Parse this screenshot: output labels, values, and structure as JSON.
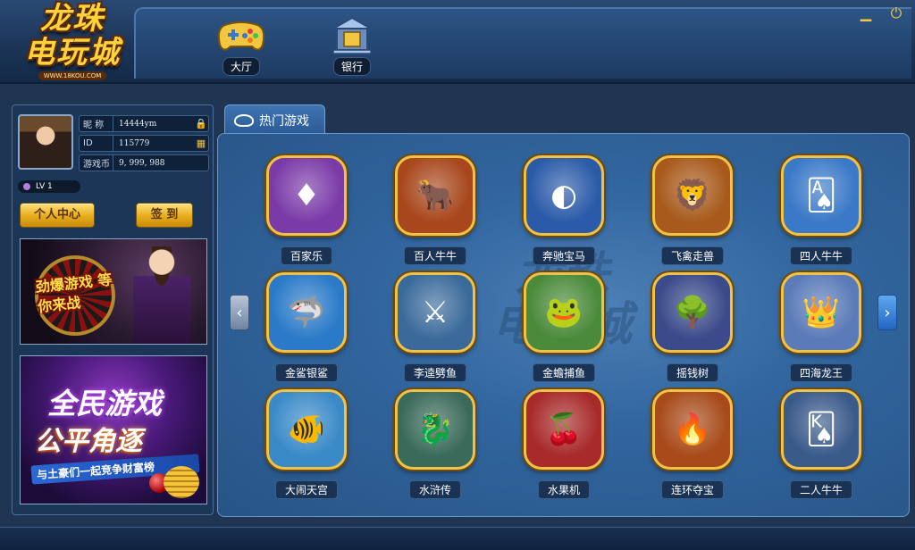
{
  "logo": {
    "line1": "龙珠",
    "line2": "电玩城",
    "url": "WWW.18KOU.COM"
  },
  "nav": [
    {
      "label": "大厅",
      "icon": "gamepad-icon"
    },
    {
      "label": "银行",
      "icon": "bank-icon"
    }
  ],
  "window": {
    "minimize_icon": "minimize-icon",
    "power_icon": "power-icon"
  },
  "user": {
    "nickname_label": "昵 称",
    "nickname": "14444ym",
    "id_label": "ID",
    "id": "115779",
    "coins_label": "游戏币",
    "coins": "9, 999, 988",
    "level": "LV  1"
  },
  "buttons": {
    "profile": "个人中心",
    "checkin": "签 到"
  },
  "banners": {
    "banner1_text": "劲爆游戏 等你来战",
    "banner2_title": "全民游戏",
    "banner2_title2": "公平角逐",
    "banner2_sub": "与土豪们一起竞争财富榜"
  },
  "tab": {
    "label": "热门游戏"
  },
  "watermark": "龙珠\n电玩城",
  "games": [
    {
      "label": "百家乐",
      "icon": "baccarat-icon",
      "bg": "#7a3aa8",
      "deco": "♦"
    },
    {
      "label": "百人牛牛",
      "icon": "bull-icon",
      "bg": "#a8461c",
      "deco": "🐂"
    },
    {
      "label": "奔驰宝马",
      "icon": "bmw-icon",
      "bg": "#2a5aa8",
      "deco": "◐"
    },
    {
      "label": "飞禽走兽",
      "icon": "lion-icon",
      "bg": "#a85a1c",
      "deco": "🦁"
    },
    {
      "label": "四人牛牛",
      "icon": "bull-cards-icon",
      "bg": "#3a78c8",
      "deco": "🂡"
    },
    {
      "label": "金鲨银鲨",
      "icon": "shark-icon",
      "bg": "#2a7ac8",
      "deco": "🦈"
    },
    {
      "label": "李逵劈鱼",
      "icon": "warrior-icon",
      "bg": "#3a6a9a",
      "deco": "⚔"
    },
    {
      "label": "金蟾捕鱼",
      "icon": "toad-icon",
      "bg": "#4a8a3a",
      "deco": "🐸"
    },
    {
      "label": "摇钱树",
      "icon": "money-tree-icon",
      "bg": "#3a4a8a",
      "deco": "🌳"
    },
    {
      "label": "四海龙王",
      "icon": "dragon-king-icon",
      "bg": "#5a7ab8",
      "deco": "👑"
    },
    {
      "label": "大闹天宫",
      "icon": "clownfish-icon",
      "bg": "#3a8ac8",
      "deco": "🐠"
    },
    {
      "label": "水浒传",
      "icon": "dragon-icon",
      "bg": "#3a6a5a",
      "deco": "🐉"
    },
    {
      "label": "水果机",
      "icon": "slots-icon",
      "bg": "#a82a2a",
      "deco": "🍒"
    },
    {
      "label": "连环夺宝",
      "icon": "golden-dragon-icon",
      "bg": "#a84a1a",
      "deco": "🔥"
    },
    {
      "label": "二人牛牛",
      "icon": "bull-poker-icon",
      "bg": "#3a5a8a",
      "deco": "🂮"
    }
  ]
}
